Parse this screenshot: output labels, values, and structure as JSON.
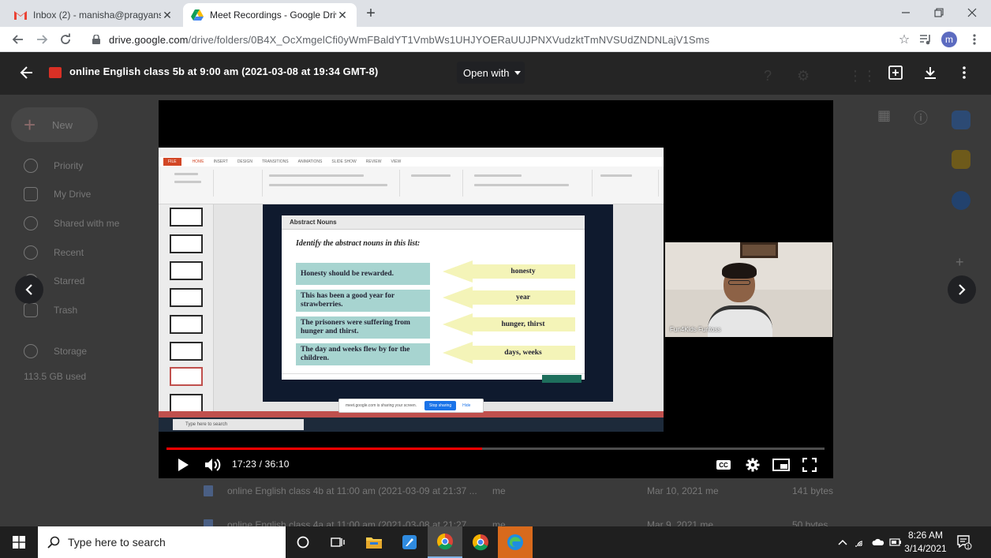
{
  "browser": {
    "tabs": [
      {
        "title": "Inbox (2) - manisha@pragyansch",
        "icon": "gmail-icon",
        "active": false
      },
      {
        "title": "Meet Recordings - Google Drive",
        "icon": "google-drive-icon",
        "active": true
      }
    ],
    "url_host": "drive.google.com",
    "url_path": "/drive/folders/0B4X_OcXmgelCfi0yWmFBaldYT1VmbWs1UHJYOERaUUJPNXVudzktTmNVSUdZNDNLajV1Sms",
    "profile_initial": "m"
  },
  "drive": {
    "new_label": "New",
    "sidebar": [
      {
        "label": "Priority"
      },
      {
        "label": "My Drive"
      },
      {
        "label": "Shared with me"
      },
      {
        "label": "Recent"
      },
      {
        "label": "Starred"
      },
      {
        "label": "Trash"
      },
      {
        "label": "Storage"
      }
    ],
    "storage_used": "113.5 GB used",
    "files": [
      {
        "name": "online English class 4b at 11:00 am (2021-03-09 at 21:37 ...",
        "owner": "me",
        "modified": "Mar 10, 2021 me",
        "size": "141 bytes"
      },
      {
        "name": "online English class 4a at 11:00 am (2021-03-08 at 21:27 ...",
        "owner": "me",
        "modified": "Mar 9, 2021 me",
        "size": "50 bytes"
      }
    ]
  },
  "preview": {
    "title": "online English class 5b at 9:00 am (2021-03-08 at 19:34 GMT-8)",
    "open_with": "Open with"
  },
  "video": {
    "current_time": "17:23",
    "duration": "36:10",
    "time_display": "17:23 / 36:10",
    "progress_fraction": 0.48,
    "cc_label": "CC",
    "participant_name": "Fun4Kids Funtoss",
    "slide": {
      "header": "Abstract Nouns",
      "question_prefix": "Identify the",
      "question_em": "abstract nouns",
      "question_suffix": "in this list:",
      "rows": [
        {
          "sentence": "Honesty should be rewarded.",
          "answer": "honesty"
        },
        {
          "sentence": "This has been a good year for strawberries.",
          "answer": "year"
        },
        {
          "sentence": "The prisoners were suffering from hunger and thirst.",
          "answer": "hunger, thirst"
        },
        {
          "sentence": "The day and weeks flew by for the children.",
          "answer": "days, weeks"
        }
      ]
    },
    "ppt": {
      "tabs": [
        "FILE",
        "HOME",
        "INSERT",
        "DESIGN",
        "TRANSITIONS",
        "ANIMATIONS",
        "SLIDE SHOW",
        "REVIEW",
        "VIEW"
      ],
      "share_text": "meet.google.com is sharing your screen.",
      "stop_sharing": "Stop sharing",
      "hide": "Hide",
      "search_hint": "Type here to search"
    }
  },
  "taskbar": {
    "search_placeholder": "Type here to search",
    "time": "8:26 AM",
    "date": "3/14/2021",
    "notification_count": "1"
  },
  "colors": {
    "accent": "#1a73e8",
    "progress": "#ff0000",
    "meet_record": "#d93025"
  }
}
